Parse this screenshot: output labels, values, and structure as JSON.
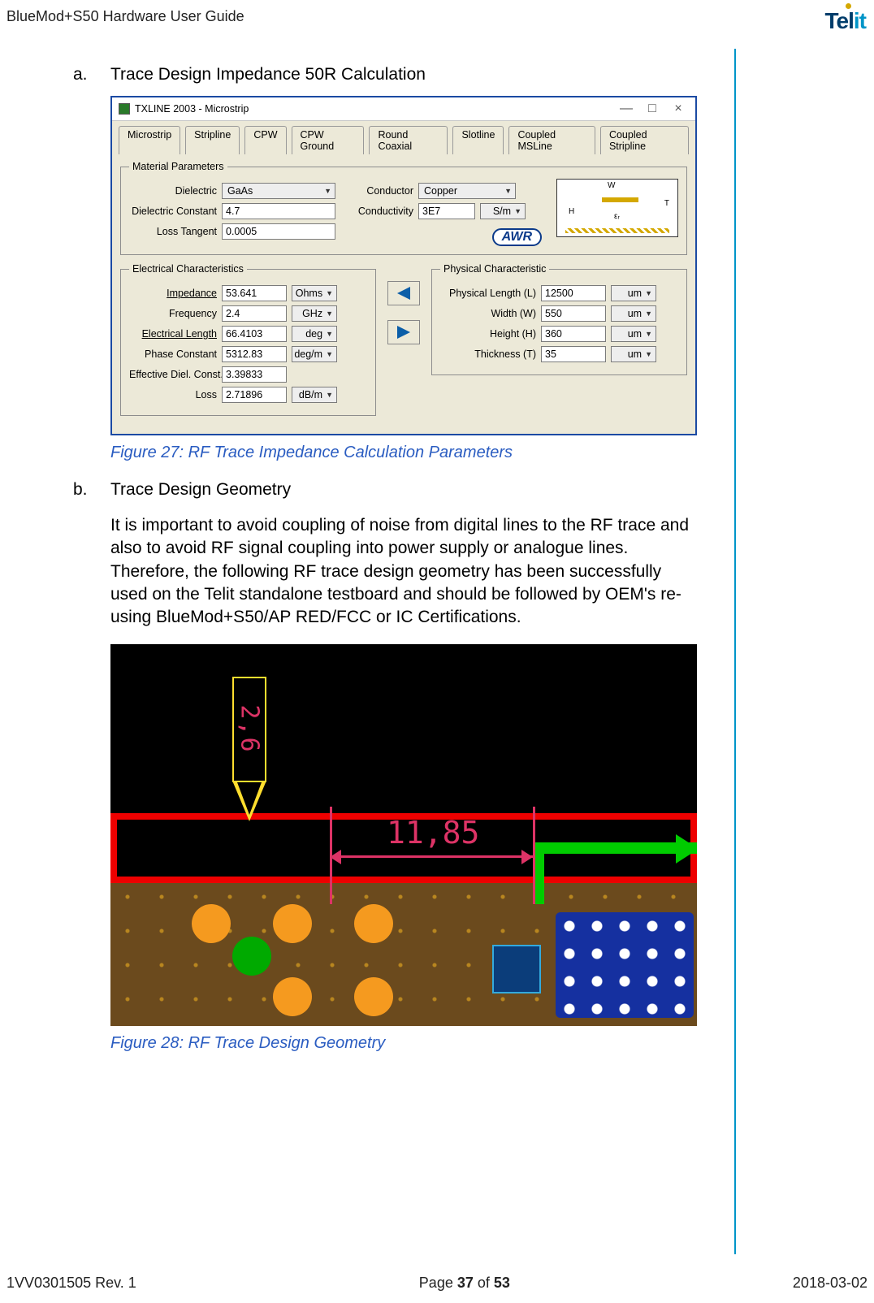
{
  "header": {
    "doc_title": "BlueMod+S50 Hardware User Guide",
    "logo_left": "Tel",
    "logo_right": "it"
  },
  "section_a": {
    "letter": "a.",
    "title": "Trace Design Impedance 50R Calculation"
  },
  "txline": {
    "window_title": "TXLINE 2003 - Microstrip",
    "win_min": "—",
    "win_max": "□",
    "win_close": "×",
    "tabs": [
      "Microstrip",
      "Stripline",
      "CPW",
      "CPW Ground",
      "Round Coaxial",
      "Slotline",
      "Coupled MSLine",
      "Coupled Stripline"
    ],
    "material": {
      "legend": "Material Parameters",
      "dielectric_label": "Dielectric",
      "dielectric_value": "GaAs",
      "diel_const_label": "Dielectric Constant",
      "diel_const_value": "4.7",
      "loss_tan_label": "Loss Tangent",
      "loss_tan_value": "0.0005",
      "conductor_label": "Conductor",
      "conductor_value": "Copper",
      "conductivity_label": "Conductivity",
      "conductivity_value": "3E7",
      "conductivity_unit": "S/m",
      "awr": "AWR"
    },
    "diagram": {
      "W": "W",
      "H": "H",
      "T": "T",
      "er": "εᵣ"
    },
    "elec": {
      "legend": "Electrical Characteristics",
      "impedance_label": "Impedance",
      "impedance_value": "53.641",
      "impedance_unit": "Ohms",
      "frequency_label": "Frequency",
      "frequency_value": "2.4",
      "frequency_unit": "GHz",
      "elec_len_label": "Electrical Length",
      "elec_len_value": "66.4103",
      "elec_len_unit": "deg",
      "phase_label": "Phase Constant",
      "phase_value": "5312.83",
      "phase_unit": "deg/m",
      "eff_diel_label": "Effective Diel. Const.",
      "eff_diel_value": "3.39833",
      "loss_label": "Loss",
      "loss_value": "2.71896",
      "loss_unit": "dB/m"
    },
    "phys": {
      "legend": "Physical Characteristic",
      "length_label": "Physical Length (L)",
      "length_value": "12500",
      "length_unit": "um",
      "width_label": "Width (W)",
      "width_value": "550",
      "width_unit": "um",
      "height_label": "Height (H)",
      "height_value": "360",
      "height_unit": "um",
      "thick_label": "Thickness (T)",
      "thick_value": "35",
      "thick_unit": "um"
    }
  },
  "caption27": "Figure 27: RF Trace Impedance Calculation Parameters",
  "section_b": {
    "letter": "b.",
    "title": "Trace Design Geometry",
    "body": "It is important to avoid coupling of noise from digital lines to the RF trace and also to avoid RF signal coupling into power supply or analogue lines. Therefore, the following RF trace design geometry has been successfully used on the Telit standalone testboard and should be followed by OEM's re-using BlueMod+S50/AP RED/FCC or IC Certifications."
  },
  "pcb": {
    "dim_h": "11,85",
    "dim_v": "2,6"
  },
  "caption28": "Figure 28: RF Trace Design Geometry",
  "footer": {
    "rev": "1VV0301505 Rev. 1",
    "page_pre": "Page ",
    "page_num": "37",
    "page_mid": " of ",
    "page_total": "53",
    "date": "2018-03-02"
  }
}
